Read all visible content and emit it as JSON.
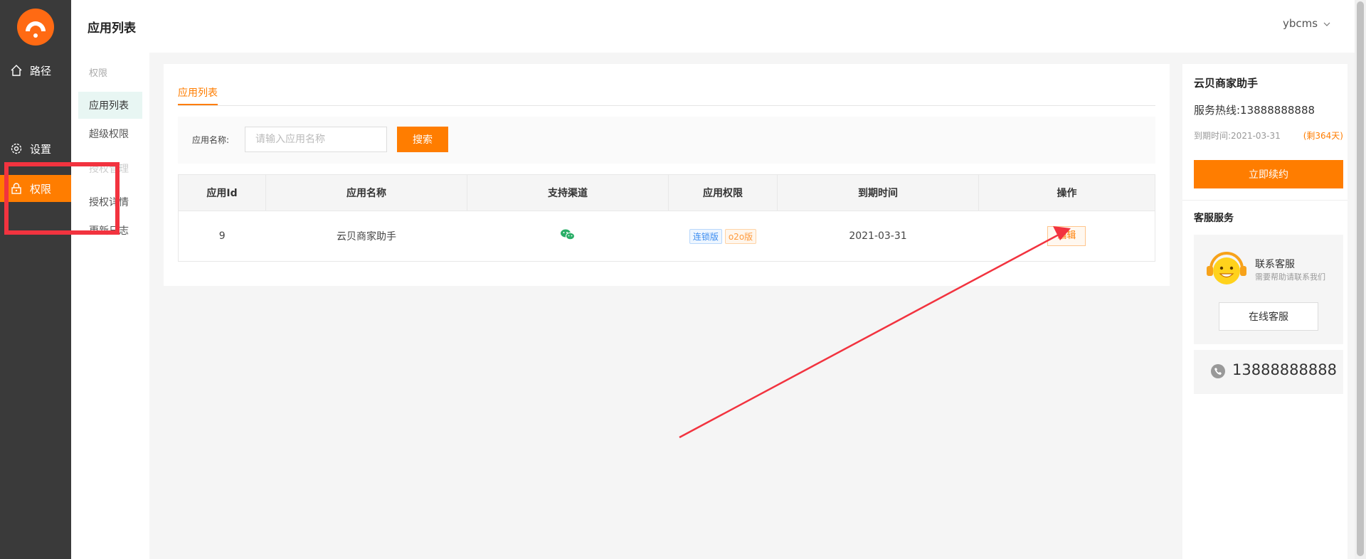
{
  "colors": {
    "accent": "#ff7d00",
    "sidebar": "#3a3a3a",
    "annotation": "#f2333f"
  },
  "nav": {
    "items": [
      {
        "label": "路径",
        "icon": "home-icon"
      },
      {
        "label": "设置",
        "icon": "gear-icon"
      },
      {
        "label": "权限",
        "icon": "lock-icon",
        "active": true
      }
    ]
  },
  "subnav": {
    "heading": "权限",
    "items": [
      "应用列表",
      "超级权限",
      "授权管理",
      "授权详情",
      "更新日志"
    ],
    "active": "应用列表"
  },
  "header": {
    "title": "应用列表",
    "user": "ybcms"
  },
  "tabs": [
    {
      "label": "应用列表",
      "active": true
    }
  ],
  "search": {
    "label": "应用名称:",
    "placeholder": "请输入应用名称",
    "button": "搜索"
  },
  "table": {
    "columns": [
      "应用Id",
      "应用名称",
      "支持渠道",
      "应用权限",
      "到期时间",
      "操作"
    ],
    "rows": [
      {
        "id": "9",
        "name": "云贝商家助手",
        "channel_icon": "wechat-icon",
        "tags": [
          "连锁版",
          "o2o版"
        ],
        "expire": "2021-03-31",
        "action": "编辑"
      }
    ]
  },
  "right_panel": {
    "shop_name": "云贝商家助手",
    "hotline": "服务热线:13888888888",
    "expire_label": "到期时间:2021-03-31",
    "expire_remain": "(剩364天)",
    "renew_button": "立即续约",
    "cs_title": "客服服务",
    "cs_contact": "联系客服",
    "cs_hint": "需要帮助请联系我们",
    "online_cs_button": "在线客服",
    "phone": "13888888888"
  }
}
